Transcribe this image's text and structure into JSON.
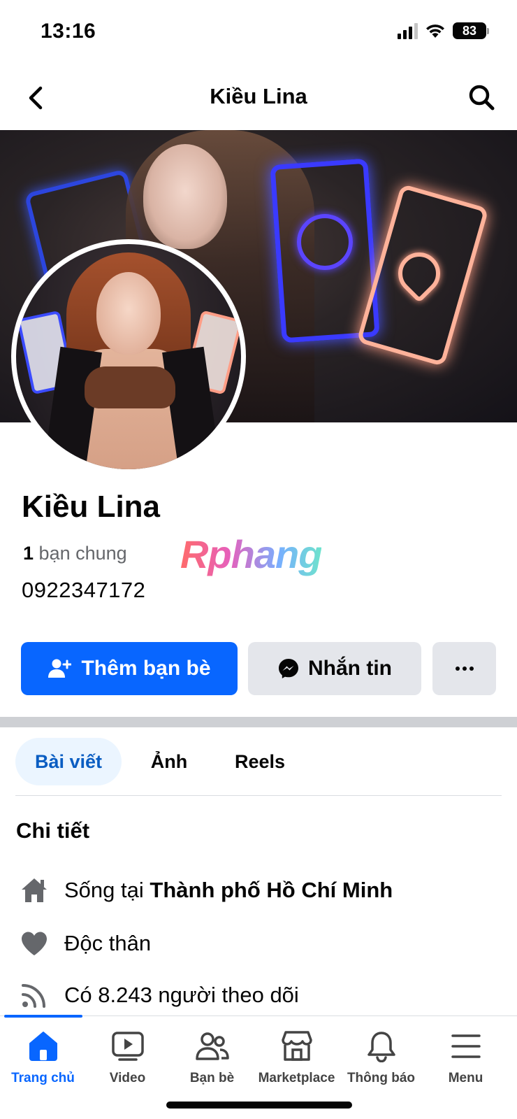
{
  "status_bar": {
    "time": "13:16",
    "battery": "83"
  },
  "header": {
    "title": "Kiều Lina",
    "back_icon": "chevron-left-icon",
    "search_icon": "search-icon"
  },
  "profile": {
    "name": "Kiều Lina",
    "mutual_count": "1",
    "mutual_label": "bạn chung",
    "phone": "0922347172"
  },
  "watermark": "Rphang",
  "actions": {
    "add_friend": "Thêm bạn bè",
    "message": "Nhắn tin",
    "more": "···"
  },
  "tabs": [
    {
      "label": "Bài viết",
      "active": true
    },
    {
      "label": "Ảnh",
      "active": false
    },
    {
      "label": "Reels",
      "active": false
    }
  ],
  "details": {
    "title": "Chi tiết",
    "lives_prefix": "Sống tại",
    "lives_city": "Thành phố Hồ Chí Minh",
    "relationship": "Độc thân",
    "followers": "Có 8.243 người theo dõi"
  },
  "bottom_nav": [
    {
      "label": "Trang chủ",
      "icon": "home-icon",
      "active": true
    },
    {
      "label": "Video",
      "icon": "video-icon",
      "active": false
    },
    {
      "label": "Bạn bè",
      "icon": "friends-icon",
      "active": false
    },
    {
      "label": "Marketplace",
      "icon": "marketplace-icon",
      "active": false
    },
    {
      "label": "Thông báo",
      "icon": "bell-icon",
      "active": false
    },
    {
      "label": "Menu",
      "icon": "menu-icon",
      "active": false
    }
  ],
  "colors": {
    "accent": "#0866ff",
    "button_gray": "#e4e6eb",
    "tab_active_bg": "#ebf5ff",
    "tab_active_text": "#0a5dc2"
  }
}
